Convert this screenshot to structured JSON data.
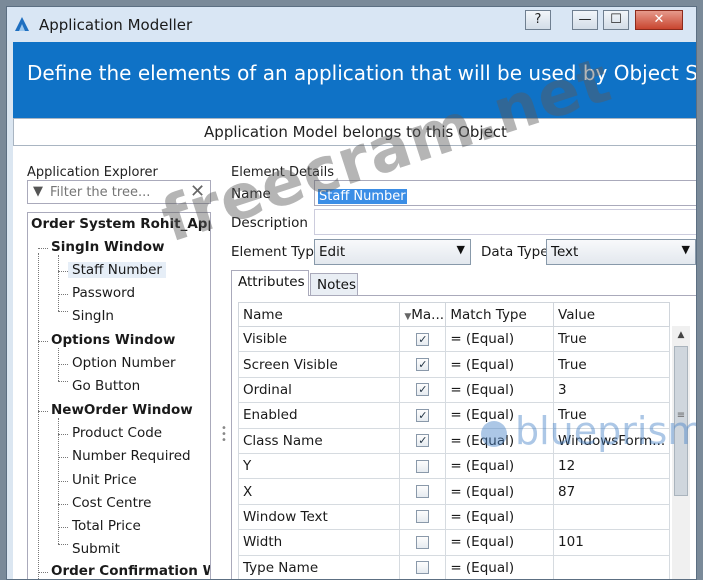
{
  "window": {
    "title": "Application Modeller",
    "buttons": {
      "help": "?",
      "minimize": "—",
      "maximize": "☐",
      "close": "✕"
    }
  },
  "banner": "Define the elements of an application that will be used by Object Studio",
  "object_strip": "Application Model belongs to this Object",
  "explorer": {
    "title": "Application Explorer",
    "filter_placeholder": "Filter the tree...",
    "root": "Order System Rohit_App",
    "windows": [
      {
        "name": "SingIn Window",
        "items": [
          "Staff Number",
          "Password",
          "SingIn"
        ]
      },
      {
        "name": "Options Window",
        "items": [
          "Option Number",
          "Go Button"
        ]
      },
      {
        "name": "NewOrder Window",
        "items": [
          "Product Code",
          "Number Required",
          "Unit Price",
          "Cost Centre",
          "Total Price",
          "Submit"
        ]
      },
      {
        "name": "Order Confirmation Window",
        "items": []
      }
    ],
    "selected_item": "Staff Number"
  },
  "details": {
    "title": "Element Details",
    "name_label": "Name",
    "name_value": "Staff Number",
    "description_label": "Description",
    "description_value": "",
    "element_type_label": "Element Type",
    "element_type_value": "Edit",
    "data_type_label": "Data Type",
    "data_type_value": "Text"
  },
  "tabs": {
    "attributes": "Attributes",
    "notes": "Notes"
  },
  "grid": {
    "headers": {
      "name": "Name",
      "match": "Ma...",
      "match_type": "Match Type",
      "value": "Value"
    },
    "rows": [
      {
        "name": "Visible",
        "checked": true,
        "match_type": "=  (Equal)",
        "value": "True"
      },
      {
        "name": "Screen Visible",
        "checked": true,
        "match_type": "=  (Equal)",
        "value": "True"
      },
      {
        "name": "Ordinal",
        "checked": true,
        "match_type": "=  (Equal)",
        "value": "3"
      },
      {
        "name": "Enabled",
        "checked": true,
        "match_type": "=  (Equal)",
        "value": "True"
      },
      {
        "name": "Class Name",
        "checked": true,
        "match_type": "=  (Equal)",
        "value": "WindowsForm..."
      },
      {
        "name": "Y",
        "checked": false,
        "match_type": "=  (Equal)",
        "value": "12"
      },
      {
        "name": "X",
        "checked": false,
        "match_type": "=  (Equal)",
        "value": "87"
      },
      {
        "name": "Window Text",
        "checked": false,
        "match_type": "=  (Equal)",
        "value": ""
      },
      {
        "name": "Width",
        "checked": false,
        "match_type": "=  (Equal)",
        "value": "101"
      },
      {
        "name": "Type Name",
        "checked": false,
        "match_type": "=  (Equal)",
        "value": ""
      }
    ]
  },
  "watermarks": {
    "site": "freecram.net",
    "logo": "blueprism"
  },
  "colors": {
    "banner": "#0f72c6",
    "selection": "#3b8ee6"
  }
}
